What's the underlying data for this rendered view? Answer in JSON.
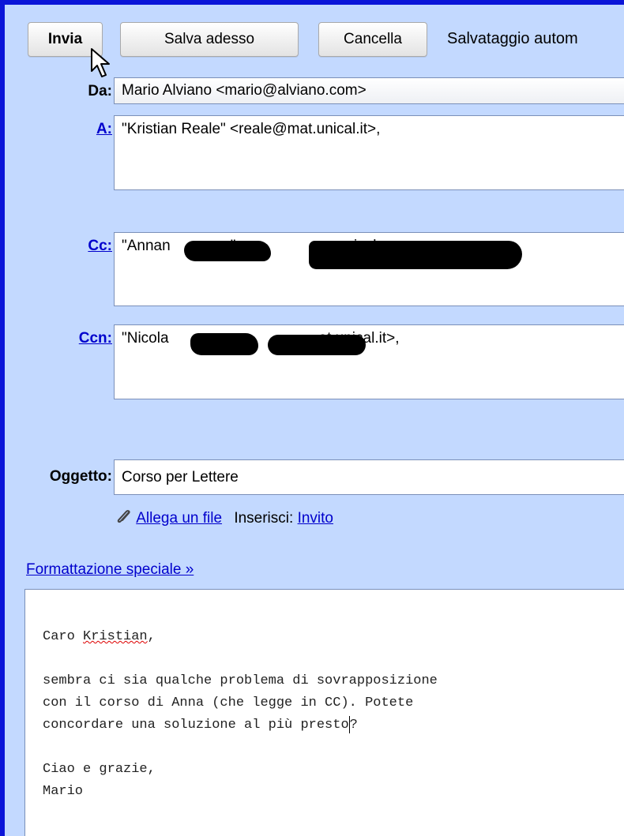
{
  "toolbar": {
    "send_label": "Invia",
    "save_now_label": "Salva adesso",
    "discard_label": "Cancella",
    "autosave_text": "Salvataggio autom"
  },
  "from": {
    "label": "Da:",
    "value": "Mario Alviano <mario@alviano.com>"
  },
  "to": {
    "label": "A:",
    "value": "\"Kristian Reale\" <reale@mat.unical.it>,"
  },
  "cc": {
    "label": "Cc:",
    "prefix": "\"Annan",
    "mid": "\" <",
    "tail_fragment": "unical",
    "end": ","
  },
  "bcc": {
    "label": "Ccn:",
    "prefix": "\"Nicola",
    "end": "at.unical.it>,"
  },
  "subject": {
    "label": "Oggetto:",
    "value": "Corso per Lettere"
  },
  "attachments": {
    "attach_link": "Allega un file",
    "insert_label": "Inserisci:",
    "invite_link": "Invito"
  },
  "formatting_link": "Formattazione speciale »",
  "body": {
    "greeting_pre": "Caro ",
    "greeting_name": "Kristian",
    "greeting_post": ",",
    "line1": "sembra ci sia qualche problema di sovrapposizione",
    "line2": "con il corso di Anna (che legge in CC). Potete",
    "line3_before_caret": "concordare una soluzione al più presto",
    "line3_after_caret": "?",
    "closing": "Ciao e grazie,",
    "signature": "Mario"
  }
}
